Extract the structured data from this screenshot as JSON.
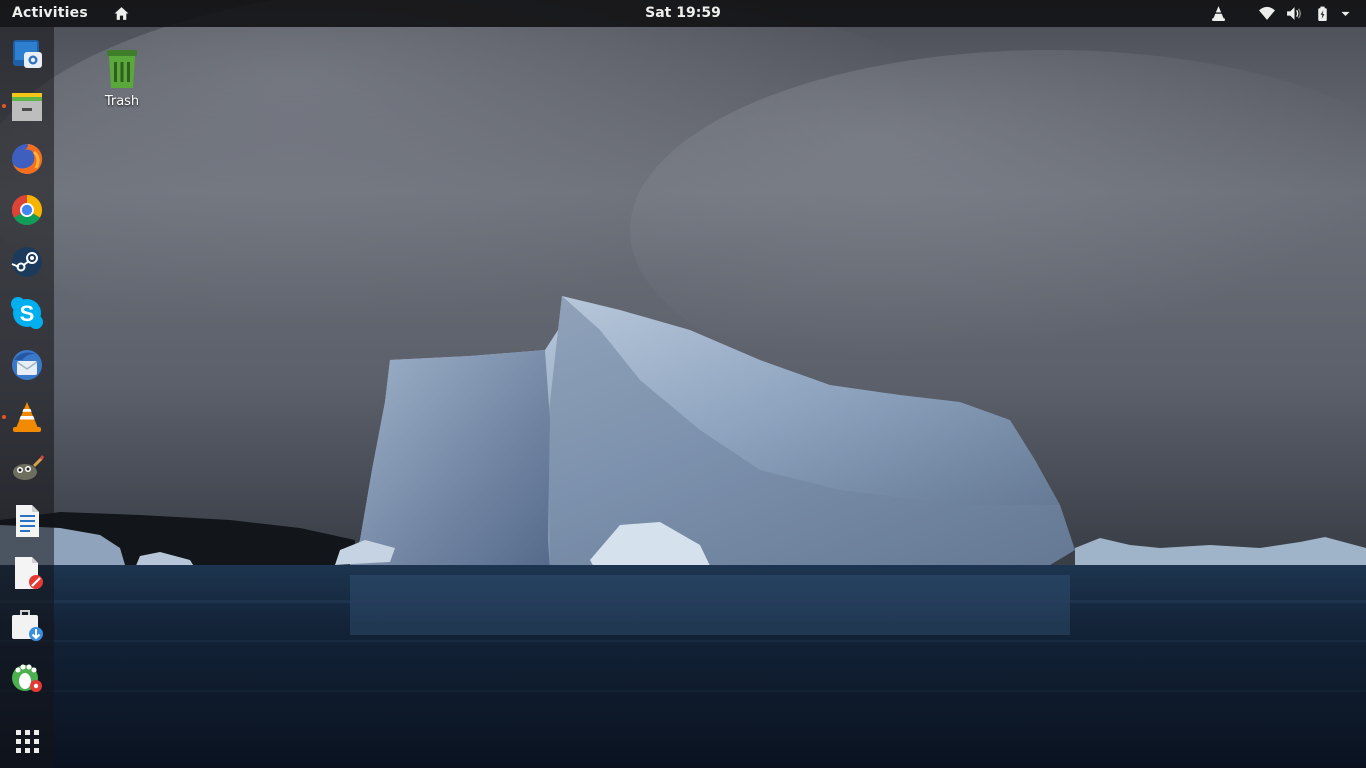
{
  "topbar": {
    "activities_label": "Activities",
    "clock": "Sat 19:59",
    "tray": [
      "vlc-tray-icon",
      "wifi-icon",
      "volume-icon",
      "battery-icon",
      "system-menu-arrow-icon"
    ]
  },
  "desktop": {
    "icons": [
      {
        "label": "Trash",
        "icon": "trash-icon"
      }
    ]
  },
  "dock": {
    "items": [
      {
        "name": "screenshot-app",
        "icon": "screenshot-icon",
        "running": false
      },
      {
        "name": "files",
        "icon": "files-icon",
        "running": true
      },
      {
        "name": "firefox",
        "icon": "firefox-icon",
        "running": false
      },
      {
        "name": "chrome",
        "icon": "chrome-icon",
        "running": false
      },
      {
        "name": "steam",
        "icon": "steam-icon",
        "running": false
      },
      {
        "name": "skype",
        "icon": "skype-icon",
        "running": false
      },
      {
        "name": "thunderbird",
        "icon": "thunderbird-icon",
        "running": false
      },
      {
        "name": "vlc",
        "icon": "vlc-icon",
        "running": true
      },
      {
        "name": "gimp",
        "icon": "gimp-icon",
        "running": false
      },
      {
        "name": "text-editor",
        "icon": "document-icon",
        "running": false
      },
      {
        "name": "document-viewer",
        "icon": "document-error-icon",
        "running": false
      },
      {
        "name": "software-install",
        "icon": "package-install-icon",
        "running": false
      },
      {
        "name": "foot-settings",
        "icon": "gnome-settings-icon",
        "running": false
      }
    ],
    "show_apps_icon": "app-grid-icon"
  },
  "colors": {
    "accent": "#e95420",
    "topbar_bg": "#101012",
    "topbar_text": "#eeeeec"
  }
}
